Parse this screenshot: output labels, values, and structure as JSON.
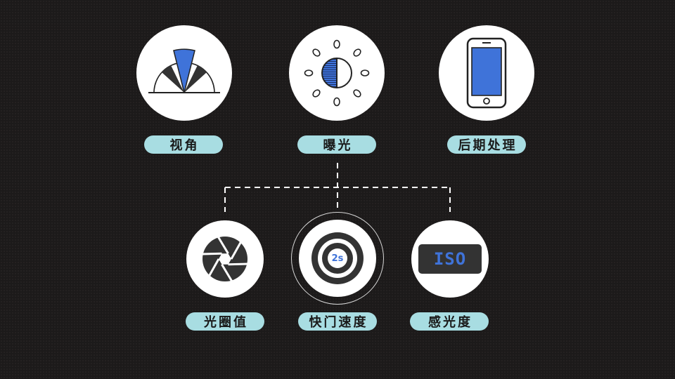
{
  "colors": {
    "background": "#1c1a1a",
    "label_bg": "#a8dde2",
    "accent_blue": "#3f73d9",
    "icon_dark": "#333333"
  },
  "top_row": [
    {
      "label": "视角",
      "icon": "viewing-angle-icon"
    },
    {
      "label": "曝光",
      "icon": "exposure-sun-icon"
    },
    {
      "label": "后期处理",
      "icon": "smartphone-icon"
    }
  ],
  "bottom_row": [
    {
      "label": "光圈值",
      "icon": "aperture-icon"
    },
    {
      "label": "快门速度",
      "icon": "shutter-lens-icon",
      "lens_text": "2s"
    },
    {
      "label": "感光度",
      "icon": "iso-icon",
      "badge_text": "ISO"
    }
  ]
}
